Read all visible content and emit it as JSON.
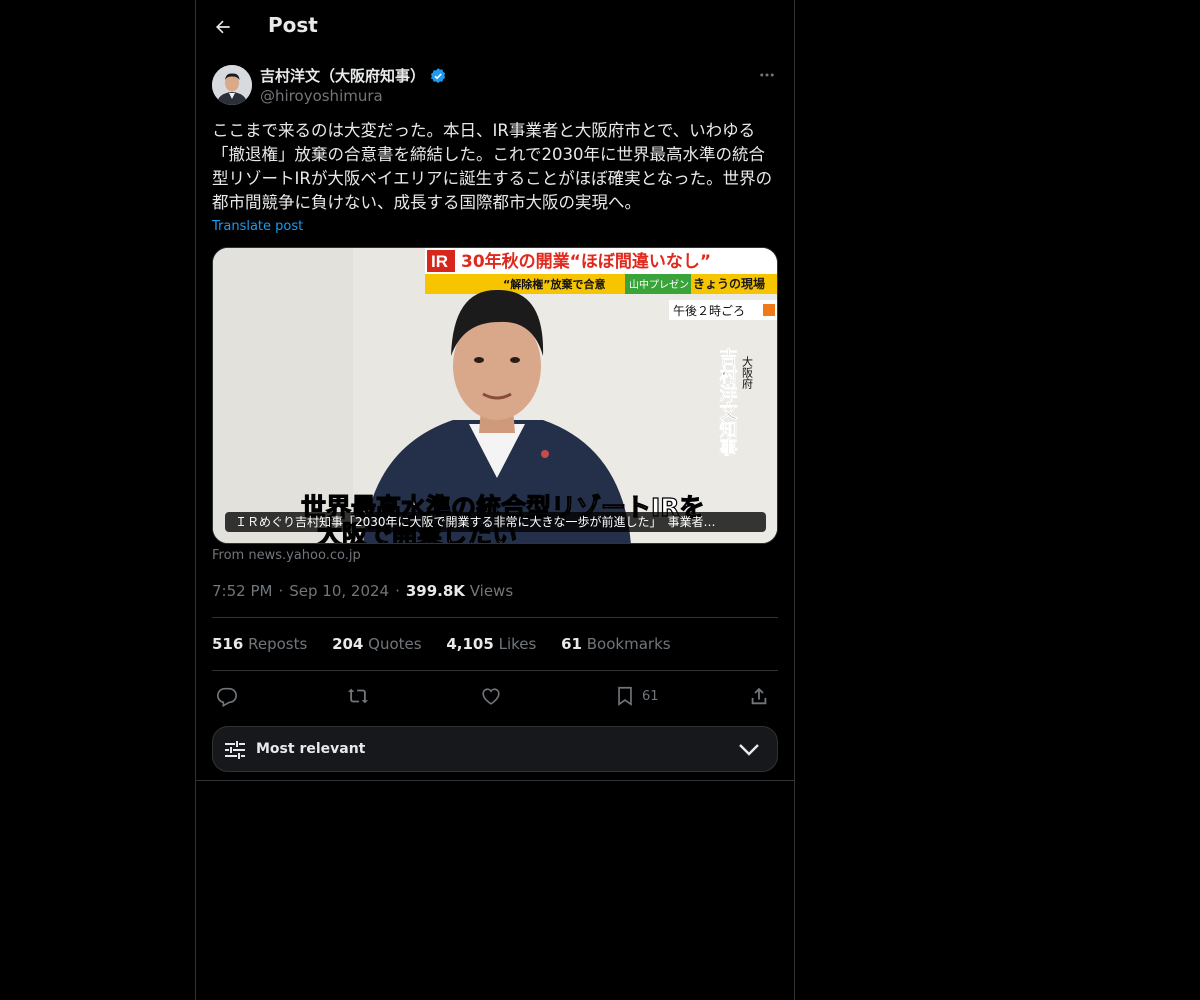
{
  "header": {
    "title": "Post",
    "back_icon": "arrow-left-icon"
  },
  "author": {
    "display_name": "吉村洋文（大阪府知事）",
    "handle": "@hiroyoshimura",
    "verified_badge_color": "#1d9bf0"
  },
  "post": {
    "text": "ここまで来るのは大変だった。本日、IR事業者と大阪府市とで、いわゆる「撤退権」放棄の合意書を締結した。これで2030年に世界最高水準の統合型リゾートIRが大阪ベイエリアに誕生することがほぼ確実となった。世界の都市間競争に負けない、成長する国際都市大阪の実現へ。",
    "translate_label": "Translate post"
  },
  "media": {
    "banner_tag": "IR",
    "banner_title": "30年秋の開業“ほぼ間違いなし”",
    "sub_banner": "“解除権”放棄で合意",
    "program": "山中プレゼン",
    "program_name": "きょうの現場",
    "time_label": "午後２時ごろ",
    "vertical_title": "大阪府",
    "vertical_name": "吉村洋文知事",
    "subtitle_line1": "世界最高水準の統合型リゾートIRを",
    "subtitle_line2": "大阪で開業したい",
    "caption": "ＩＲめぐり吉村知事「2030年に大阪で開業する非常に大きな一歩が前進した」　事業者…",
    "source": "From news.yahoo.co.jp"
  },
  "meta": {
    "time": "7:52 PM",
    "date": "Sep 10, 2024",
    "views_count": "399.8K",
    "views_label": "Views"
  },
  "stats": {
    "reposts_count": "516",
    "reposts_label": "Reposts",
    "quotes_count": "204",
    "quotes_label": "Quotes",
    "likes_count": "4,105",
    "likes_label": "Likes",
    "bookmarks_count": "61",
    "bookmarks_label": "Bookmarks"
  },
  "actions": {
    "bookmark_count": "61"
  },
  "sort": {
    "label": "Most relevant"
  }
}
